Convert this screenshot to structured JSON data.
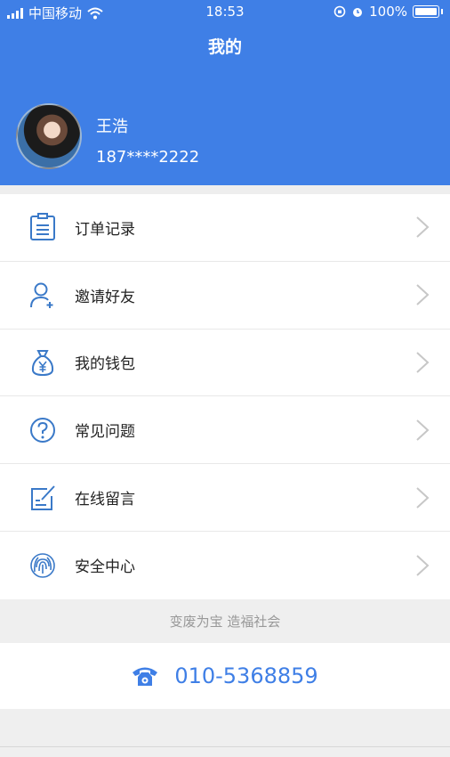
{
  "status_bar": {
    "carrier": "中国移动",
    "time": "18:53",
    "battery": "100%"
  },
  "header": {
    "title": "我的"
  },
  "profile": {
    "name": "王浩",
    "phone": "187****2222"
  },
  "menu": {
    "items": [
      {
        "label": "订单记录",
        "icon": "order-list-icon"
      },
      {
        "label": "邀请好友",
        "icon": "add-friend-icon"
      },
      {
        "label": "我的钱包",
        "icon": "wallet-icon"
      },
      {
        "label": "常见问题",
        "icon": "question-icon"
      },
      {
        "label": "在线留言",
        "icon": "message-edit-icon"
      },
      {
        "label": "安全中心",
        "icon": "fingerprint-icon"
      }
    ]
  },
  "footer": {
    "slogan": "变废为宝 造福社会",
    "hotline": "010-5368859"
  },
  "colors": {
    "primary": "#3f7fe6",
    "icon": "#3a79c8"
  }
}
